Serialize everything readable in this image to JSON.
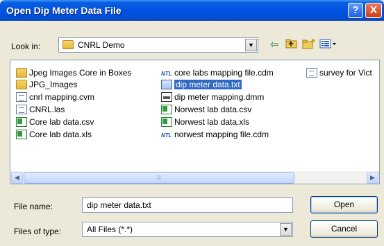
{
  "window": {
    "title": "Open Dip Meter Data File",
    "help_glyph": "?",
    "close_glyph": "X"
  },
  "toolbar": {
    "look_in_label": "Look in:",
    "look_in_value": "CNRL Demo",
    "back_icon": "back-arrow-icon",
    "up_icon": "up-folder-icon",
    "new_folder_icon": "new-folder-icon",
    "views_icon": "views-menu-icon"
  },
  "files": {
    "col1": [
      {
        "name": "Jpeg Images Core in Boxes",
        "type": "folder"
      },
      {
        "name": "JPG_Images",
        "type": "folder"
      },
      {
        "name": "cnrl mapping.cvm",
        "type": "doc"
      },
      {
        "name": "CNRL.las",
        "type": "doc"
      },
      {
        "name": "Core lab data.csv",
        "type": "excel"
      },
      {
        "name": "Core lab data.xls",
        "type": "excel"
      }
    ],
    "col2": [
      {
        "name": "core labs mapping file.cdm",
        "type": "cdm"
      },
      {
        "name": "dip meter data.txt",
        "type": "txt",
        "selected": true
      },
      {
        "name": "dip meter mapping.dmm",
        "type": "dmm"
      },
      {
        "name": "Norwest lab data.csv",
        "type": "excel"
      },
      {
        "name": "Norwest lab data.xls",
        "type": "excel"
      },
      {
        "name": "norwest mapping file.cdm",
        "type": "cdm"
      }
    ],
    "col3": [
      {
        "name": "survey for Vict",
        "type": "doc"
      }
    ]
  },
  "fields": {
    "file_name_label": "File name:",
    "file_name_value": "dip meter data.txt",
    "files_of_type_label": "Files of type:",
    "files_of_type_value": "All Files (*.*)"
  },
  "buttons": {
    "open": "Open",
    "cancel": "Cancel"
  },
  "colors": {
    "selection": "#316ac5",
    "titlebar": "#0054e3",
    "dialog_bg": "#ece9d8"
  }
}
